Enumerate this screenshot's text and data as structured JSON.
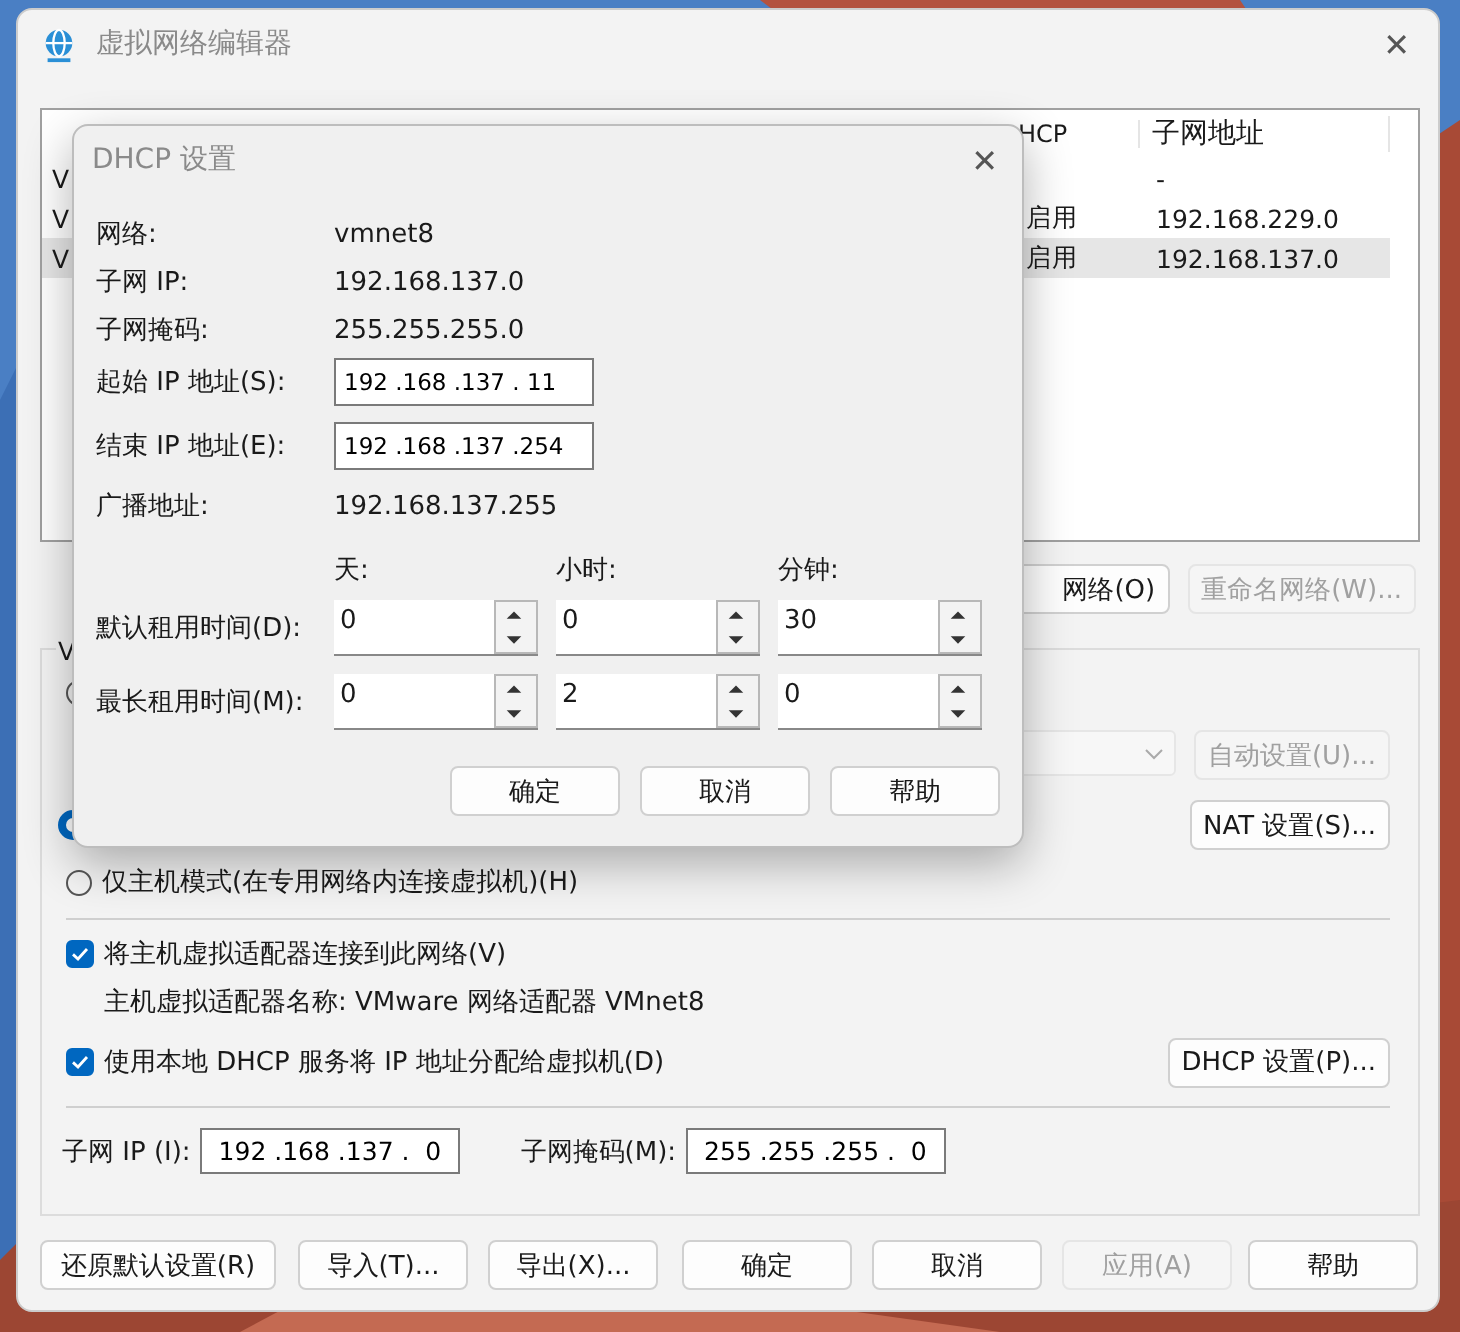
{
  "window": {
    "title": "虚拟网络编辑器",
    "close": "✕"
  },
  "network_list": {
    "columns": [
      {
        "label": "HCP"
      },
      {
        "label": "子网地址"
      }
    ],
    "rows": [
      {
        "name": "V",
        "subnet": "-",
        "selected": false
      },
      {
        "name": "V",
        "dhcp": "启用",
        "subnet": "192.168.229.0",
        "selected": false
      },
      {
        "name": "V",
        "dhcp": "启用",
        "subnet": "192.168.137.0",
        "selected": true
      }
    ]
  },
  "list_buttons": [
    {
      "label": "网络(O)",
      "disabled": false
    },
    {
      "label": "重命名网络(W)...",
      "disabled": true
    }
  ],
  "group": {
    "title": "V",
    "radios": [
      {
        "selected": false
      },
      {
        "selected": true
      },
      {
        "label": "仅主机模式(在专用网络内连接虚拟机)(H)",
        "selected": false
      }
    ],
    "auto_button": {
      "label": "自动设置(U)...",
      "disabled": true
    },
    "nat_button": {
      "label": "NAT 设置(S)...",
      "disabled": false
    },
    "connect_adapter": {
      "label": "将主机虚拟适配器连接到此网络(V)",
      "checked": true
    },
    "adapter_name": "主机虚拟适配器名称: VMware 网络适配器 VMnet8",
    "use_dhcp": {
      "label": "使用本地 DHCP 服务将 IP 地址分配给虚拟机(D)",
      "checked": true
    },
    "dhcp_button": {
      "label": "DHCP 设置(P)...",
      "disabled": false
    },
    "subnet_ip": {
      "label": "子网 IP (I):",
      "value": "192 .168 .137 .  0"
    },
    "subnet_mask": {
      "label": "子网掩码(M):",
      "value": "255 .255 .255 .  0"
    }
  },
  "bottom_buttons": [
    {
      "label": "还原默认设置(R)",
      "disabled": false
    },
    {
      "label": "导入(T)...",
      "disabled": false
    },
    {
      "label": "导出(X)...",
      "disabled": false
    },
    {
      "label": "确定",
      "disabled": false
    },
    {
      "label": "取消",
      "disabled": false
    },
    {
      "label": "应用(A)",
      "disabled": true
    },
    {
      "label": "帮助",
      "disabled": false
    }
  ],
  "dhcp_dialog": {
    "title": "DHCP 设置",
    "close": "✕",
    "info": [
      {
        "label": "网络:",
        "value": "vmnet8",
        "kind": "text"
      },
      {
        "label": "子网 IP:",
        "value": "192.168.137.0",
        "kind": "text"
      },
      {
        "label": "子网掩码:",
        "value": "255.255.255.0",
        "kind": "text"
      },
      {
        "label": "起始 IP 地址(S):",
        "value": "192 .168 .137 . 11",
        "kind": "field"
      },
      {
        "label": "结束 IP 地址(E):",
        "value": "192 .168 .137 .254",
        "kind": "field"
      },
      {
        "label": "广播地址:",
        "value": "192.168.137.255",
        "kind": "text"
      }
    ],
    "lease_units": [
      "天:",
      "小时:",
      "分钟:"
    ],
    "leases": [
      {
        "label": "默认租用时间(D):",
        "values": [
          "0",
          "0",
          "30"
        ]
      },
      {
        "label": "最长租用时间(M):",
        "values": [
          "0",
          "2",
          "0"
        ]
      }
    ],
    "buttons": [
      "确定",
      "取消",
      "帮助"
    ]
  }
}
